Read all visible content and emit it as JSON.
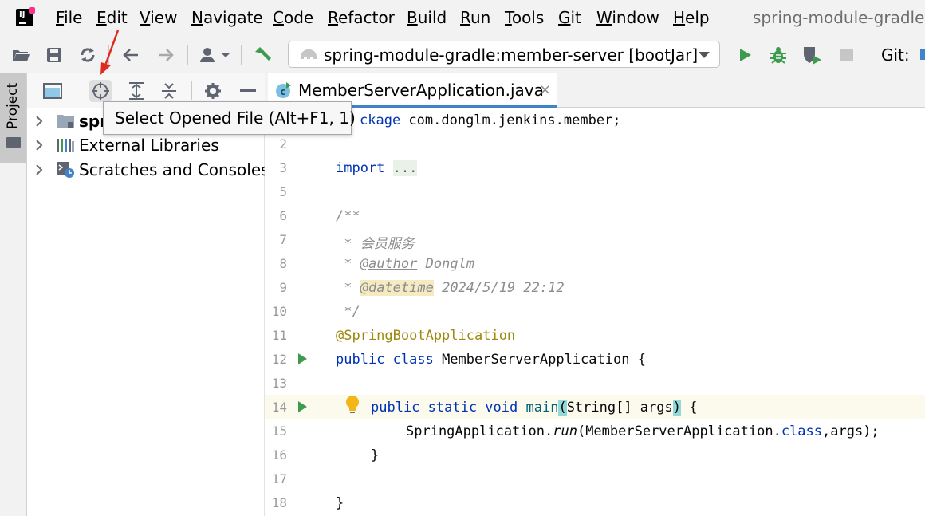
{
  "menu": {
    "items": [
      {
        "name": "menu-file",
        "mnemonic": "F",
        "rest": "ile"
      },
      {
        "name": "menu-edit",
        "mnemonic": "E",
        "rest": "dit"
      },
      {
        "name": "menu-view",
        "mnemonic": "V",
        "rest": "iew"
      },
      {
        "name": "menu-navigate",
        "mnemonic": "N",
        "rest": "avigate"
      },
      {
        "name": "menu-code",
        "mnemonic": "C",
        "rest": "ode"
      },
      {
        "name": "menu-refactor",
        "mnemonic": "R",
        "rest": "efactor"
      },
      {
        "name": "menu-build",
        "mnemonic": "B",
        "rest": "uild"
      },
      {
        "name": "menu-run",
        "mnemonic": "R",
        "rest": "un"
      },
      {
        "name": "menu-tools",
        "mnemonic": "T",
        "rest": "ools"
      },
      {
        "name": "menu-git",
        "mnemonic": "G",
        "rest": "it"
      },
      {
        "name": "menu-window",
        "mnemonic": "W",
        "rest": "indow"
      },
      {
        "name": "menu-help",
        "mnemonic": "H",
        "rest": "elp"
      }
    ],
    "window_title": "spring-module-gradle"
  },
  "toolbar": {
    "run_config": "spring-module-gradle:member-server [bootJar]",
    "git_label": "Git:",
    "icons": [
      "open-folder-icon",
      "save-icon",
      "sync-icon",
      "back-arrow-icon",
      "forward-arrow-icon",
      "user-icon",
      "build-hammer-icon",
      "run-icon",
      "debug-icon",
      "coverage-icon",
      "stop-icon"
    ]
  },
  "stripe": {
    "project_tab": "Project"
  },
  "project_panel": {
    "ellipsis": "...",
    "tree": [
      {
        "label": "spr",
        "bold": true,
        "icon": "module-folder-icon"
      },
      {
        "label": "External Libraries",
        "bold": false,
        "icon": "libraries-icon"
      },
      {
        "label": "Scratches and Consoles",
        "bold": false,
        "icon": "scratches-icon"
      }
    ]
  },
  "tooltip": {
    "text": "Select Opened File (Alt+F1, 1)"
  },
  "editor": {
    "tab_label": "MemberServerApplication.java",
    "tab_close": "×",
    "lines": {
      "pkg_kw": "ckage",
      "pkg_name": " com.donglm.jenkins.member;",
      "import_kw": "import",
      "import_fold": "...",
      "doc_open": "/**",
      "doc_desc": " * 会员服务",
      "doc_star": " * ",
      "author_tag": "@author",
      "author_val": " Donglm",
      "datetime_tag": "@datetime",
      "datetime_val": " 2024/5/19 22:12",
      "doc_close": " */",
      "annotation": "@SpringBootApplication",
      "class_kw": "public class",
      "class_name": " MemberServerApplication {",
      "main_kw": "public static void",
      "main_name": "main",
      "main_paren_open": "(",
      "main_params": "String[] args",
      "main_paren_close": ")",
      "main_brace": " {",
      "run_obj": "SpringApplication.",
      "run_meth": "run",
      "run_args_a": "(MemberServerApplication.",
      "run_class_kw": "class",
      "run_args_b": ",args);",
      "close_inner": "}",
      "close_outer": "}"
    },
    "line_numbers": [
      "2",
      "3",
      "5",
      "6",
      "7",
      "8",
      "9",
      "10",
      "11",
      "12",
      "13",
      "14",
      "15",
      "16",
      "17",
      "18"
    ]
  }
}
